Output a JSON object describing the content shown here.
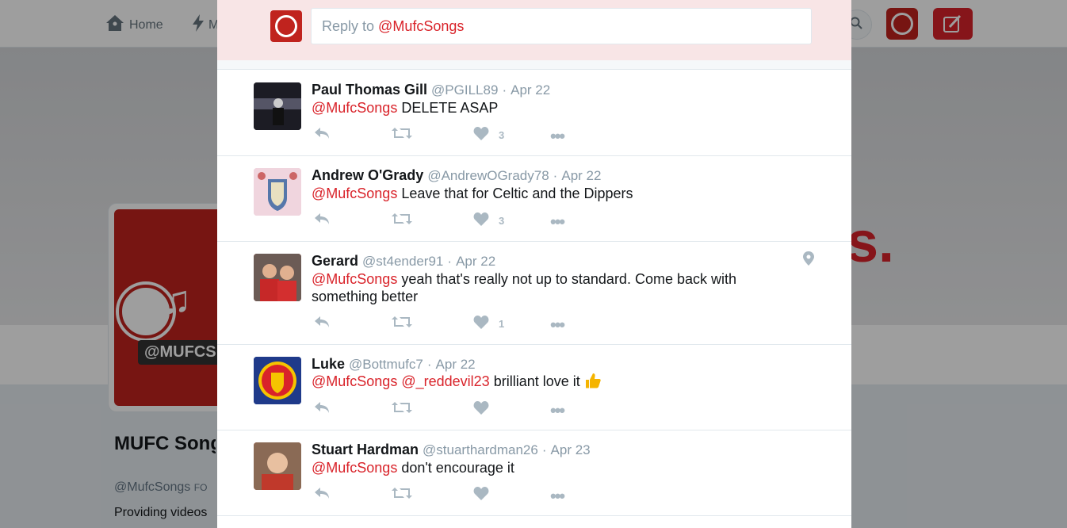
{
  "background": {
    "nav": {
      "home_label": "Home",
      "moments_label": "M"
    },
    "banner_text": "s.",
    "profile_card_label": "@MUFCS",
    "profile_name": "MUFC Songs Chants™",
    "profile_handle": "@MufcSongs",
    "profile_follows": "FO",
    "profile_bio": "Providing videos"
  },
  "reply": {
    "placeholder_prefix": "Reply to ",
    "placeholder_mention": "@MufcSongs"
  },
  "tweets": [
    {
      "name": "Paul Thomas Gill",
      "handle": "@PGILL89",
      "date": "Apr 22",
      "mention": "@MufcSongs",
      "text": " DELETE ASAP",
      "likes": "3",
      "avatar_color": "#2b2b2b"
    },
    {
      "name": "Andrew O'Grady",
      "handle": "@AndrewOGrady78",
      "date": "Apr 22",
      "mention": "@MufcSongs",
      "text": " Leave that for Celtic and the Dippers",
      "likes": "3",
      "avatar_color": "#d8a9b8"
    },
    {
      "name": "Gerard",
      "handle": "@st4ender91",
      "date": "Apr 22",
      "mention": "@MufcSongs",
      "text": " yeah that's really not up to standard. Come back with something better",
      "likes": "1",
      "avatar_color": "#b33a2e",
      "has_location": true
    },
    {
      "name": "Luke",
      "handle": "@Bottmufc7",
      "date": "Apr 22",
      "mention": "@MufcSongs",
      "mention2": "@_reddevil23",
      "text": " brilliant love it ",
      "likes": "",
      "avatar_color": "#1f3a8a"
    },
    {
      "name": "Stuart Hardman",
      "handle": "@stuarthardman26",
      "date": "Apr 23",
      "mention": "@MufcSongs",
      "text": " don't encourage it",
      "likes": "",
      "avatar_color": "#c0392b"
    }
  ],
  "icons": {
    "reply": "reply-arrow",
    "retweet": "retweet-arrows",
    "like": "heart",
    "more": "ellipsis",
    "location": "map-pin",
    "thumbs_up": "thumbs-up-emoji"
  },
  "colors": {
    "brand": "#d9232a",
    "reply_bg": "#f8e5e6",
    "action_gray": "#aab8c2"
  }
}
